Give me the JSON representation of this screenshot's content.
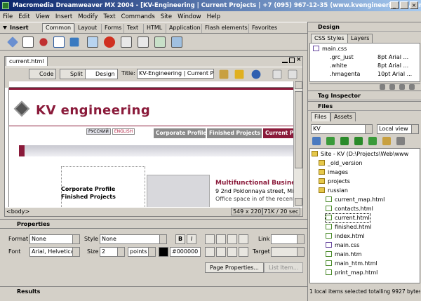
{
  "window": {
    "title": "Macromedia Dreamweaver MX 2004 - [KV-Engineering | Current Projects | +7 (095) 967-12-35 (www.kvengineering.ru/curre..."
  },
  "menu": [
    "File",
    "Edit",
    "View",
    "Insert",
    "Modify",
    "Text",
    "Commands",
    "Site",
    "Window",
    "Help"
  ],
  "insert_bar": {
    "label": "Insert",
    "tabs": [
      "Common",
      "Layout",
      "Forms",
      "Text",
      "HTML",
      "Application",
      "Flash elements",
      "Favorites"
    ],
    "active": "Common"
  },
  "document": {
    "tab": "current.html",
    "views": [
      "Code",
      "Split",
      "Design"
    ],
    "active_view": "Design",
    "title_label": "Title:",
    "title_value": "KV-Engineering | Current Proje",
    "tag_selector": "<body>",
    "status_size": "549 x 220",
    "status_weight": "71K / 20 sec"
  },
  "page": {
    "logo": "KV engineering",
    "lang_ru": "РУССКИЙ",
    "lang_en": "ENGLISH",
    "nav": [
      "Corporate Profile",
      "Finished Projects",
      "Current Pr"
    ],
    "side_links": [
      "Corporate Profile",
      "Finished Projects"
    ],
    "heading": "Multifunctional Busines",
    "address": "9 2nd Poklonnaya street, Mi",
    "address2": "Office space in of the recent"
  },
  "properties": {
    "header": "Properties",
    "format_label": "Format",
    "format_value": "None",
    "style_label": "Style",
    "style_value": "None",
    "font_label": "Font",
    "font_value": "Arial, Helvetica",
    "size_label": "Size",
    "size_value": "2",
    "units_value": "points",
    "color_value": "#000000",
    "link_label": "Link",
    "target_label": "Target",
    "page_props_button": "Page Properties...",
    "list_item_button": "List Item..."
  },
  "results_label": "Results",
  "right_panel": {
    "design_header": "Design",
    "design_tabs": [
      "CSS Styles",
      "Layers"
    ],
    "css_file": "main.css",
    "css_rules": [
      {
        "name": ".grc_just",
        "value": "8pt Arial ..."
      },
      {
        "name": ".white",
        "value": "8pt Arial ..."
      },
      {
        "name": ".hmagenta",
        "value": "10pt Arial ..."
      }
    ],
    "tag_inspector_header": "Tag Inspector",
    "files_header": "Files",
    "files_tabs": [
      "Files",
      "Assets"
    ],
    "site_select": "KV",
    "view_select": "Local view",
    "tree_root": "Site - KV (D:\\Projects\\Web\\www",
    "folders": [
      "_old_version",
      "images",
      "projects",
      "russian"
    ],
    "files": [
      "current_map.html",
      "contacts.html",
      "current.html",
      "finished.html",
      "index.html",
      "main.css",
      "main.htm",
      "main_htm.html",
      "print_map.html"
    ],
    "selected_file": "current.html",
    "status": "1 local items selected totalling 9927 bytes."
  }
}
